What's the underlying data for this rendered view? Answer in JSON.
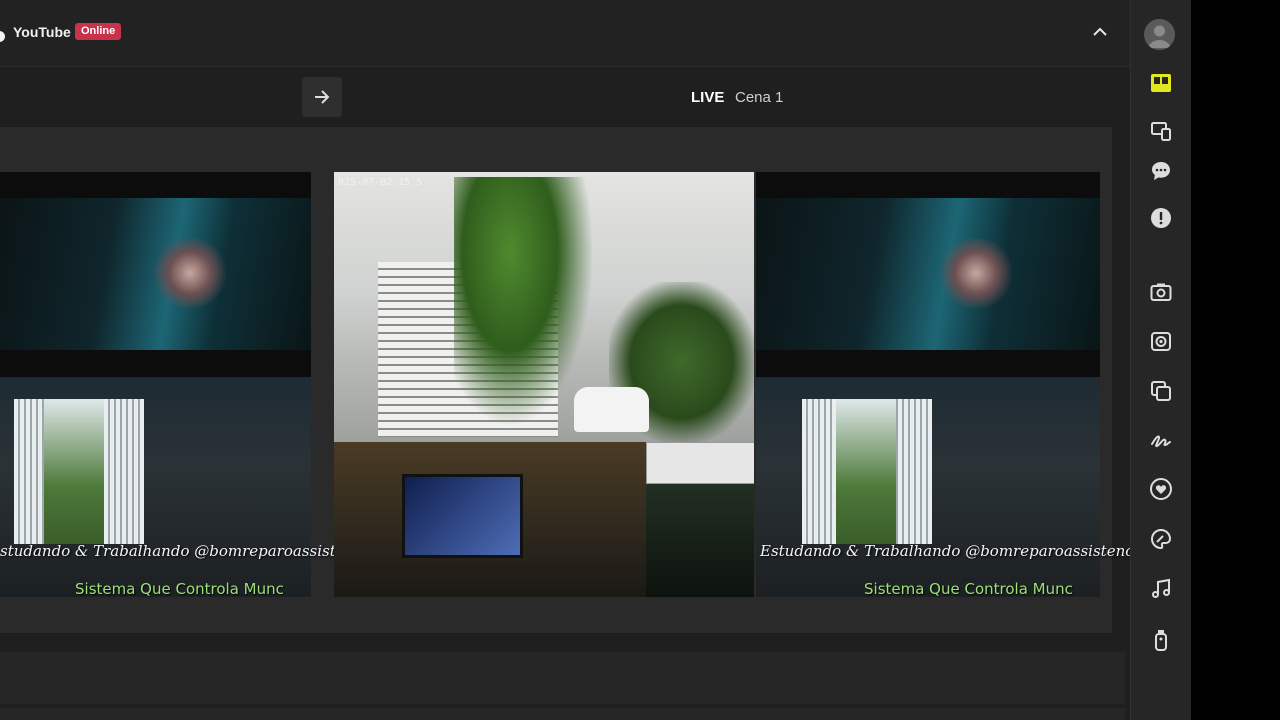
{
  "header": {
    "platform_name": "YouTube",
    "status_badge": "Online",
    "collapse_icon": "chevron-up-icon"
  },
  "studio": {
    "arrow_icon": "arrow-right-icon",
    "live_label": "LIVE",
    "scene_name": "Cena 1"
  },
  "previews": {
    "overlay_line1": "Estudando & Trabalhando @bomreparoassistenc",
    "overlay_line2": "Sistema Que Controla Munc",
    "left_overlay_line1": "studando & Trabalhando @bomreparoassistenc",
    "left_overlay_line2": "Sistema Que Controla Munc",
    "center_camera_timestamp": "025-07-02 15 5"
  },
  "sidebar": {
    "icons": [
      "avatar-icon",
      "layout-icon",
      "devices-icon",
      "chat-icon",
      "alert-icon",
      "camera-icon",
      "virtual-camera-icon",
      "layers-icon",
      "signature-icon",
      "heart-icon",
      "palette-icon",
      "music-icon",
      "remote-icon"
    ]
  },
  "colors": {
    "accent_yellow": "#e0e81e",
    "badge_red": "#c8324a",
    "overlay_green": "#9be07a"
  }
}
